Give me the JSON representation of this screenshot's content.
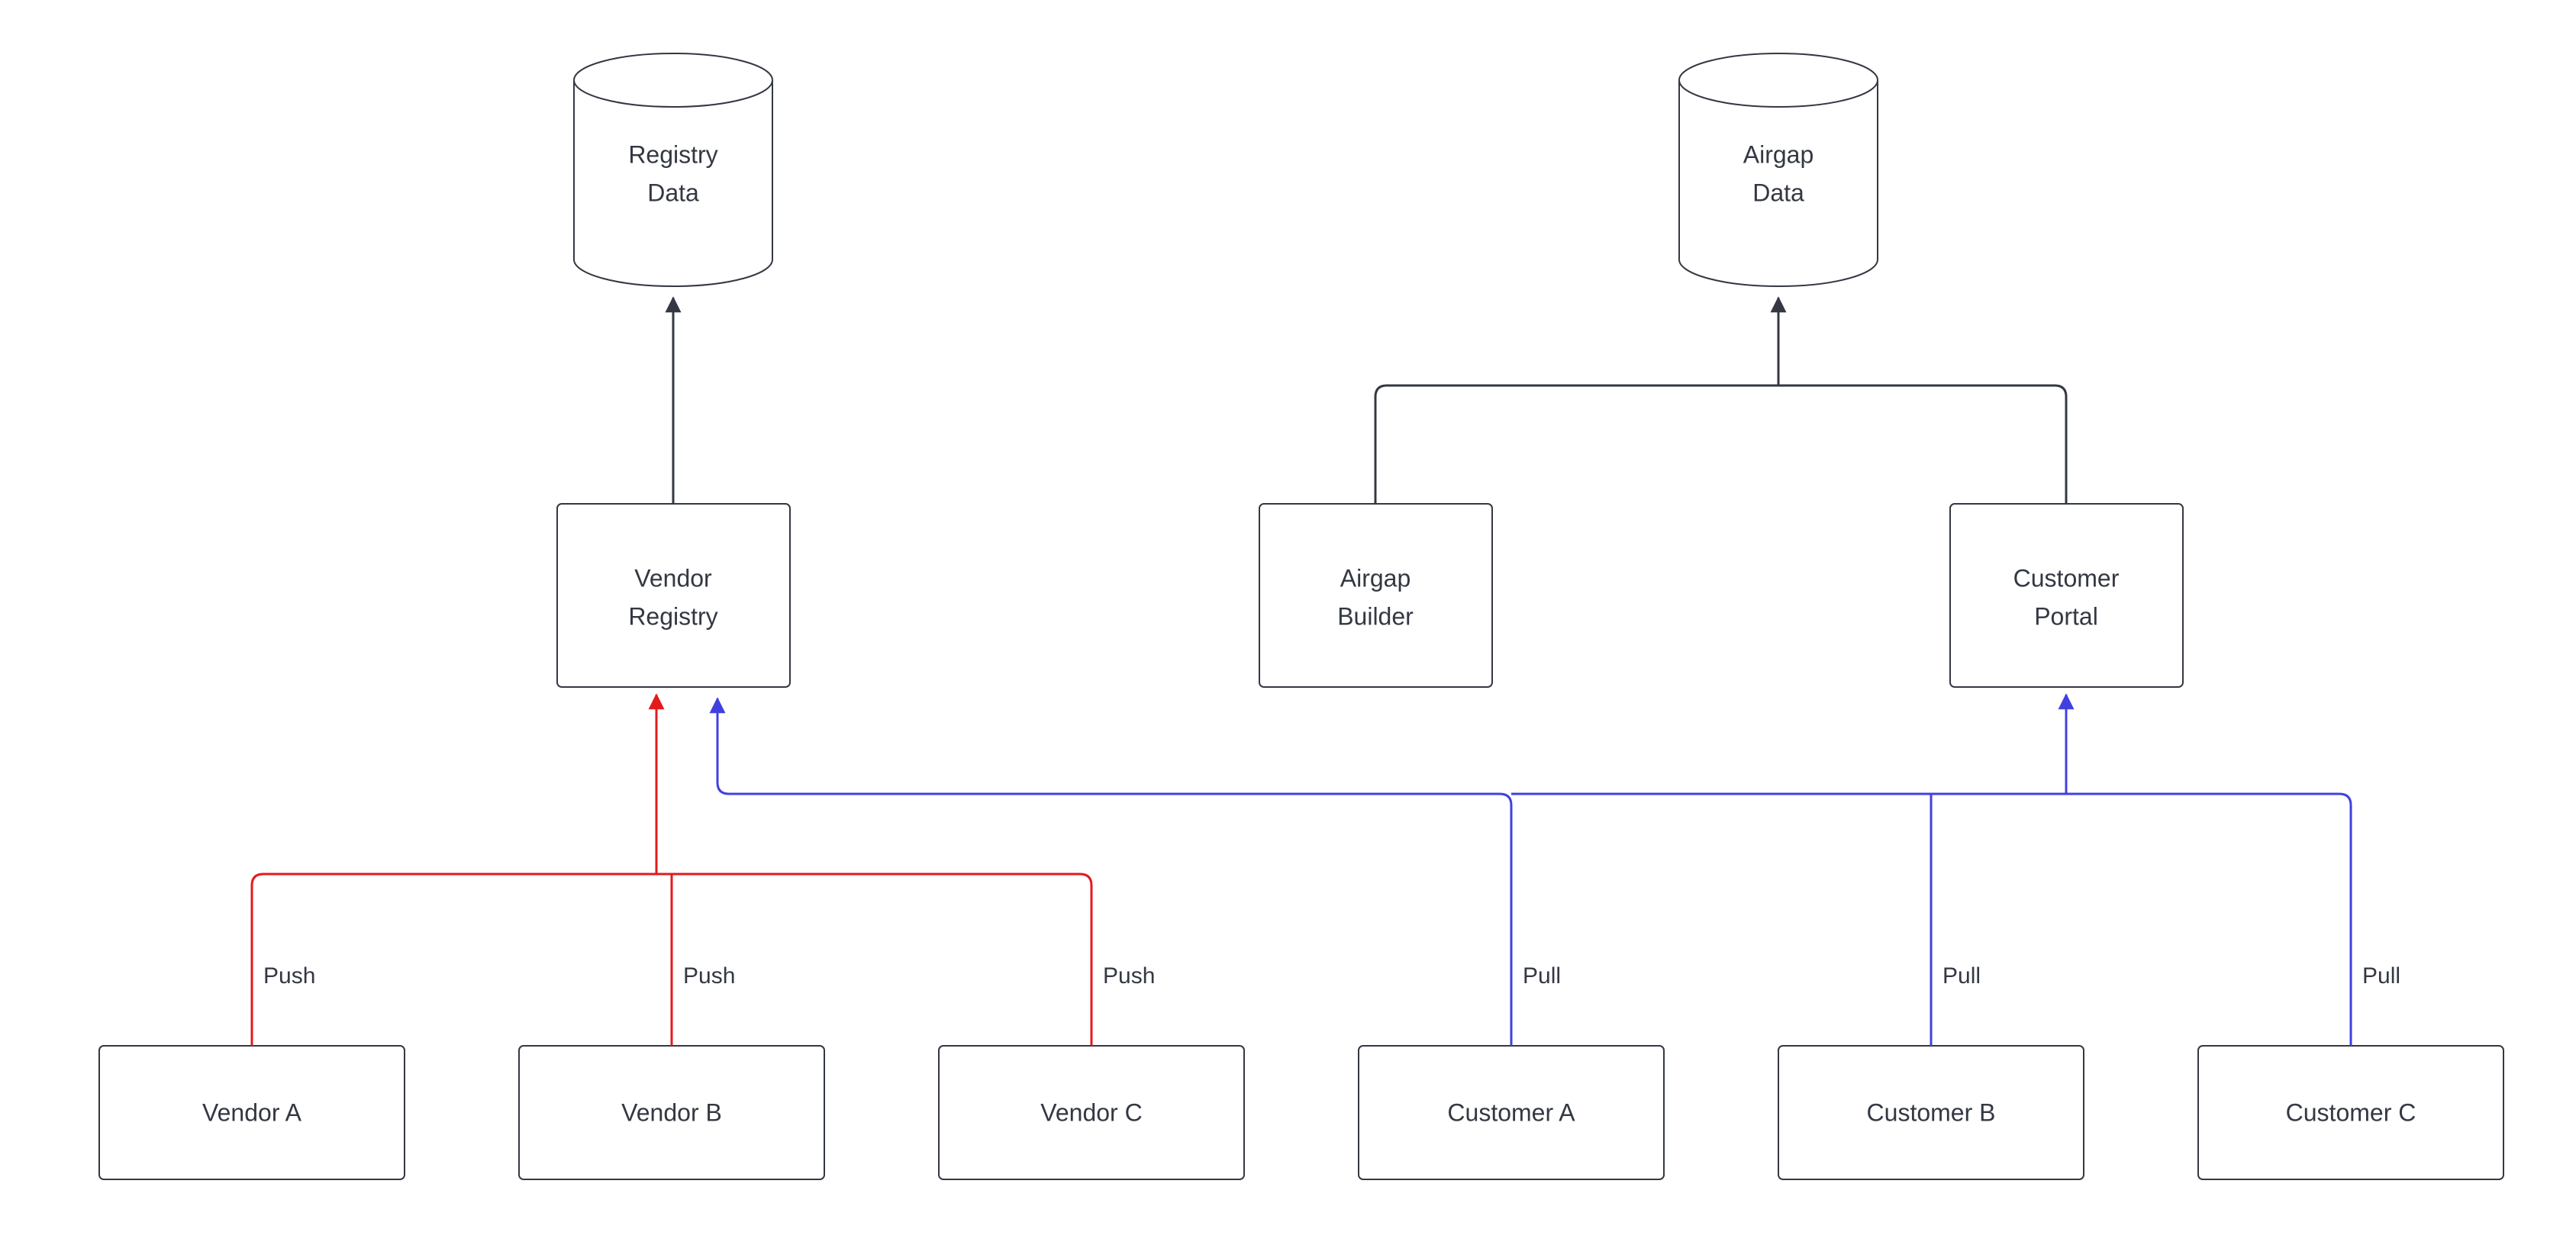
{
  "diagram": {
    "nodes": {
      "registry_data": {
        "label1": "Registry",
        "label2": "Data"
      },
      "airgap_data": {
        "label1": "Airgap",
        "label2": "Data"
      },
      "vendor_registry": {
        "label1": "Vendor",
        "label2": "Registry"
      },
      "airgap_builder": {
        "label1": "Airgap",
        "label2": "Builder"
      },
      "customer_portal": {
        "label1": "Customer",
        "label2": "Portal"
      },
      "vendor_a": {
        "label": "Vendor A"
      },
      "vendor_b": {
        "label": "Vendor B"
      },
      "vendor_c": {
        "label": "Vendor C"
      },
      "customer_a": {
        "label": "Customer A"
      },
      "customer_b": {
        "label": "Customer B"
      },
      "customer_c": {
        "label": "Customer C"
      }
    },
    "edge_labels": {
      "push_a": "Push",
      "push_b": "Push",
      "push_c": "Push",
      "pull_a": "Pull",
      "pull_b": "Pull",
      "pull_c": "Pull"
    },
    "colors": {
      "stroke": "#333842",
      "push": "#e31a1c",
      "pull": "#4040e0"
    }
  }
}
